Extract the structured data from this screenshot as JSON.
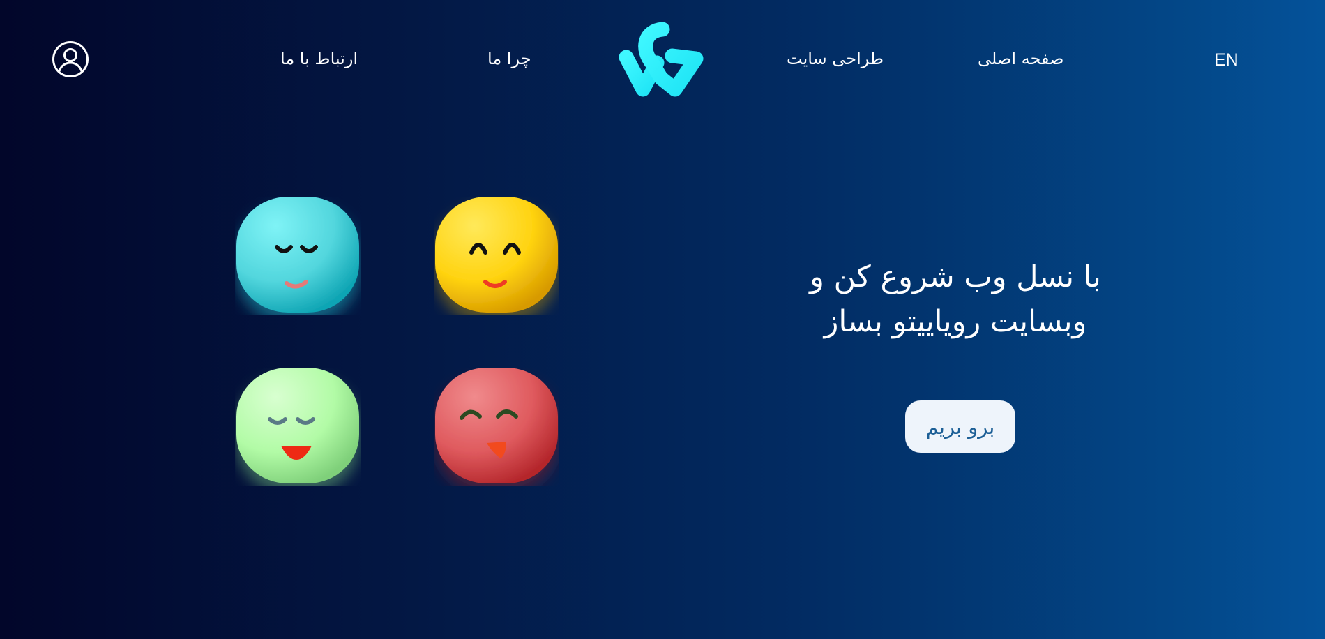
{
  "header": {
    "lang_label": "EN",
    "nav": {
      "home": "صفحه اصلی",
      "design": "طراحی سایت",
      "why": "چرا ما",
      "contact": "ارتباط با ما"
    },
    "logo_icon": "wg-logo",
    "user_icon": "user-circle-icon",
    "logo_color": "#2ef2ff"
  },
  "hero": {
    "title_line1": "با نسل وب شروع کن و",
    "title_line2": "وبسایت رویاییتو بساز",
    "cta_label": "برو بریم"
  },
  "illustration": {
    "faces": [
      {
        "name": "cyan-smiling-face",
        "color": "#5ad9e0"
      },
      {
        "name": "yellow-happy-face",
        "color": "#ffd21a"
      },
      {
        "name": "green-calm-face",
        "color": "#b2fba6"
      },
      {
        "name": "red-tongue-face",
        "color": "#e05a5e"
      }
    ]
  },
  "colors": {
    "background_start": "#02062a",
    "background_end": "#04529a",
    "button_bg": "#eef4fb",
    "button_text": "#1c5f96"
  }
}
